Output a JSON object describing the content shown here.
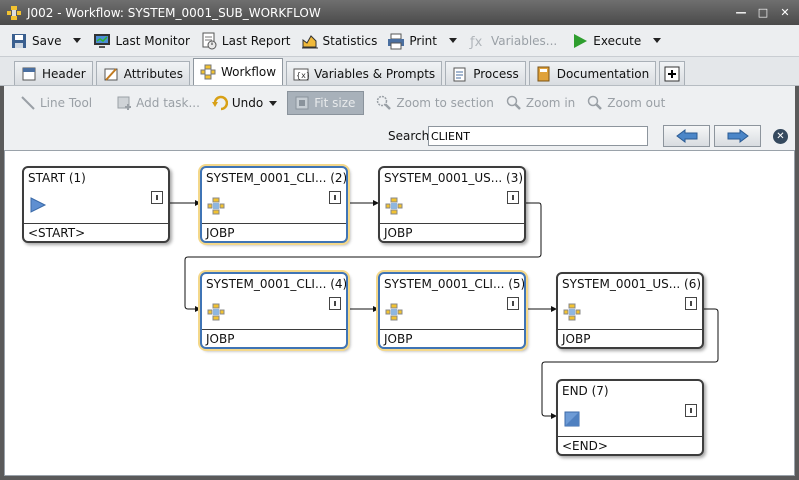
{
  "window": {
    "title": "J002 - Workflow: SYSTEM_0001_SUB_WORKFLOW"
  },
  "toolbar": {
    "save": "Save",
    "last_monitor": "Last Monitor",
    "last_report": "Last Report",
    "statistics": "Statistics",
    "print": "Print",
    "variables": "Variables...",
    "execute": "Execute"
  },
  "tabs": [
    "Header",
    "Attributes",
    "Workflow",
    "Variables & Prompts",
    "Process",
    "Documentation"
  ],
  "workflow_toolbar": {
    "line_tool": "Line Tool",
    "add_task": "Add task...",
    "undo": "Undo",
    "fit_size": "Fit size",
    "zoom_section": "Zoom to section",
    "zoom_in": "Zoom in",
    "zoom_out": "Zoom out"
  },
  "search": {
    "label": "Search",
    "value": "CLIENT"
  },
  "nodes": [
    {
      "title": "START (1)",
      "footer": "<START>"
    },
    {
      "title": "SYSTEM_0001_CLI... (2)",
      "footer": "JOBP"
    },
    {
      "title": "SYSTEM_0001_US... (3)",
      "footer": "JOBP"
    },
    {
      "title": "SYSTEM_0001_CLI... (4)",
      "footer": "JOBP"
    },
    {
      "title": "SYSTEM_0001_CLI... (5)",
      "footer": "JOBP"
    },
    {
      "title": "SYSTEM_0001_US... (6)",
      "footer": "JOBP"
    },
    {
      "title": "END (7)",
      "footer": "<END>"
    }
  ],
  "colors": {
    "titlebar": "#5a5a5a",
    "highlight": "#f4d88a",
    "execute_green": "#2e9e2e"
  }
}
